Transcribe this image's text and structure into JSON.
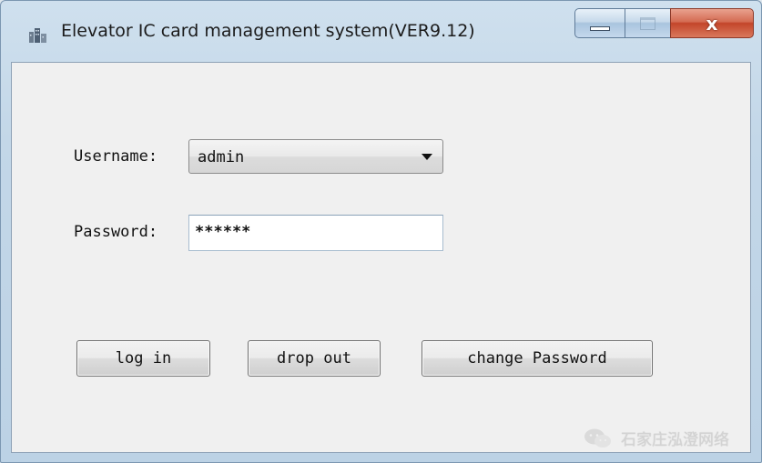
{
  "window": {
    "title": "Elevator IC card management system(VER9.12)",
    "icon": "building-icon",
    "controls": {
      "minimize": "minimize-icon",
      "maximize": "maximize-icon",
      "close": "x"
    }
  },
  "form": {
    "username_label": "Username:",
    "username_value": "admin",
    "password_label": "Password:",
    "password_value": "******"
  },
  "buttons": {
    "login": "log in",
    "dropout": "drop out",
    "change_password": "change Password"
  },
  "watermark": {
    "icon": "wechat-icon",
    "text": "石家庄泓澄网络"
  },
  "colors": {
    "close_button": "#c3452a",
    "client_background": "#f0f0f0",
    "title_gradient": "#c3d7e8"
  }
}
